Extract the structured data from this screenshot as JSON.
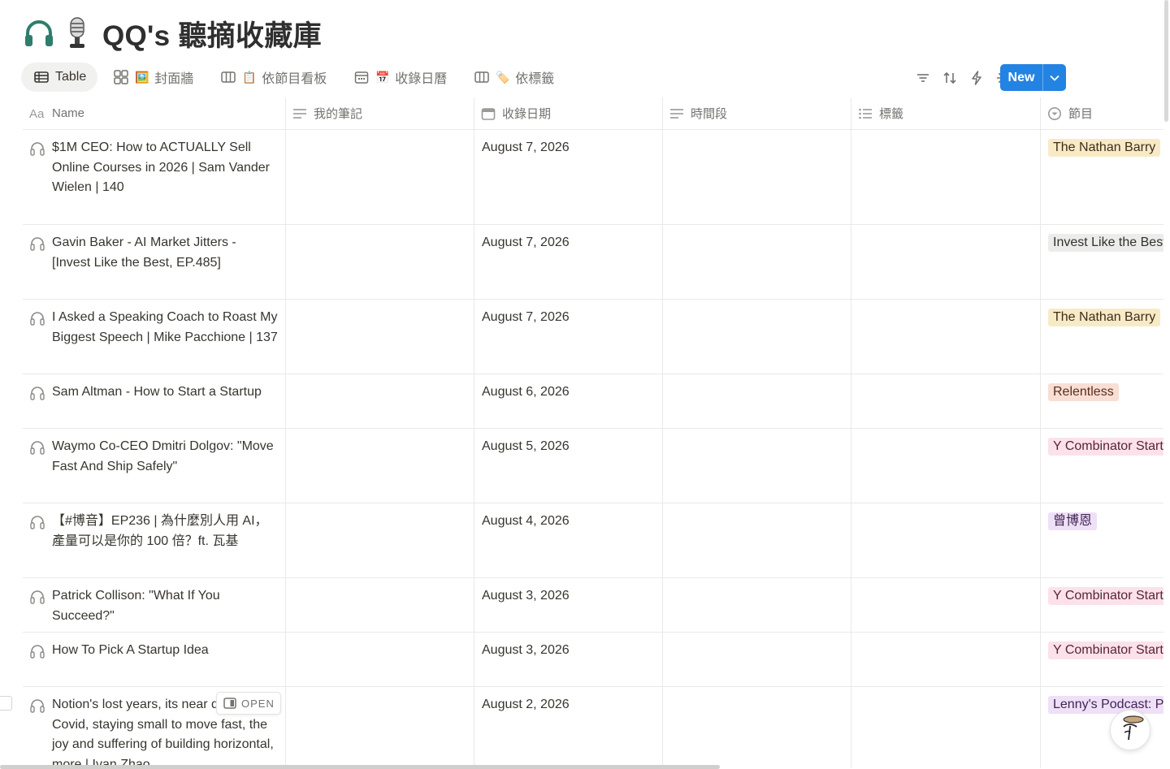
{
  "page": {
    "title": "QQ's 聽摘收藏庫",
    "icons": [
      "headphones-icon",
      "studio-microphone-icon"
    ]
  },
  "views": [
    {
      "label": "Table",
      "icon": "table-icon",
      "active": true
    },
    {
      "label": "封面牆",
      "icon": "gallery-icon",
      "emoji": "🖼️"
    },
    {
      "label": "依節目看板",
      "icon": "board-icon",
      "emoji": "📋"
    },
    {
      "label": "收錄日曆",
      "icon": "calendar-icon",
      "emoji": "📅"
    },
    {
      "label": "依標籤",
      "icon": "board-icon",
      "emoji": "🏷️"
    }
  ],
  "toolbar": {
    "icons": [
      "filter-icon",
      "sort-icon",
      "automation-icon",
      "ai-sparkle-icon",
      "search-icon",
      "settings-icon"
    ],
    "new_label": "New"
  },
  "columns": [
    {
      "label": "Name",
      "icon": "text-aa-icon"
    },
    {
      "label": "我的筆記",
      "icon": "text-lines-icon"
    },
    {
      "label": "收錄日期",
      "icon": "calendar-icon"
    },
    {
      "label": "時間段",
      "icon": "text-lines-icon"
    },
    {
      "label": "標籤",
      "icon": "list-icon"
    },
    {
      "label": "節目",
      "icon": "select-icon"
    }
  ],
  "rows": [
    {
      "name": "$1M CEO: How to ACTUALLY Sell Online Courses in 2026 | Sam Vander Wielen | 140",
      "date": "August 7, 2026",
      "show": "The Nathan Barry",
      "tag_bg": "#f7ebc6",
      "tag_fg": "#402c1b"
    },
    {
      "name": "Gavin Baker - AI Market Jitters - [Invest Like the Best, EP.485]",
      "date": "August 7, 2026",
      "show": "Invest Like the Best",
      "tag_bg": "#ececeb",
      "tag_fg": "#32302c"
    },
    {
      "name": "I Asked a Speaking Coach to Roast My Biggest Speech | Mike Pacchione |  137",
      "date": "August 7, 2026",
      "show": "The Nathan Barry",
      "tag_bg": "#f7ebc6",
      "tag_fg": "#402c1b"
    },
    {
      "name": "Sam Altman - How to Start a Startup",
      "date": "August 6, 2026",
      "show": "Relentless",
      "tag_bg": "#f8ded4",
      "tag_fg": "#5d2c1a"
    },
    {
      "name": "Waymo Co-CEO Dmitri Dolgov: \"Move Fast And Ship Safely\"",
      "date": "August 5, 2026",
      "show": "Y Combinator Startup",
      "tag_bg": "#fbe2ea",
      "tag_fg": "#5a2338"
    },
    {
      "name": "【#博音】EP236 | 為什麼別人用 AI，產量可以是你的 100 倍？ft. 瓦基",
      "date": "August 4, 2026",
      "show": "曾博恩",
      "tag_bg": "#eee0f7",
      "tag_fg": "#412454"
    },
    {
      "name": "Patrick Collison: \"What If You Succeed?\"",
      "date": "August 3, 2026",
      "show": "Y Combinator Startup",
      "tag_bg": "#fbe2ea",
      "tag_fg": "#5a2338"
    },
    {
      "name": "How To Pick A Startup Idea",
      "date": "August 3, 2026",
      "show": "Y Combinator Startup",
      "tag_bg": "#fbe2ea",
      "tag_fg": "#5a2338"
    },
    {
      "name": "Notion's lost years, its near during Covid, staying small to move fast, the joy and suffering of building horizontal, more | Ivan Zhao",
      "date": "August 2, 2026",
      "show": "Lenny's Podcast: P",
      "tag_bg": "#eee0f7",
      "tag_fg": "#412454"
    }
  ],
  "row_action": {
    "open_label": "OPEN",
    "icon": "side-peek-icon"
  },
  "assistant": {
    "icon": "notion-ai-face-icon"
  }
}
